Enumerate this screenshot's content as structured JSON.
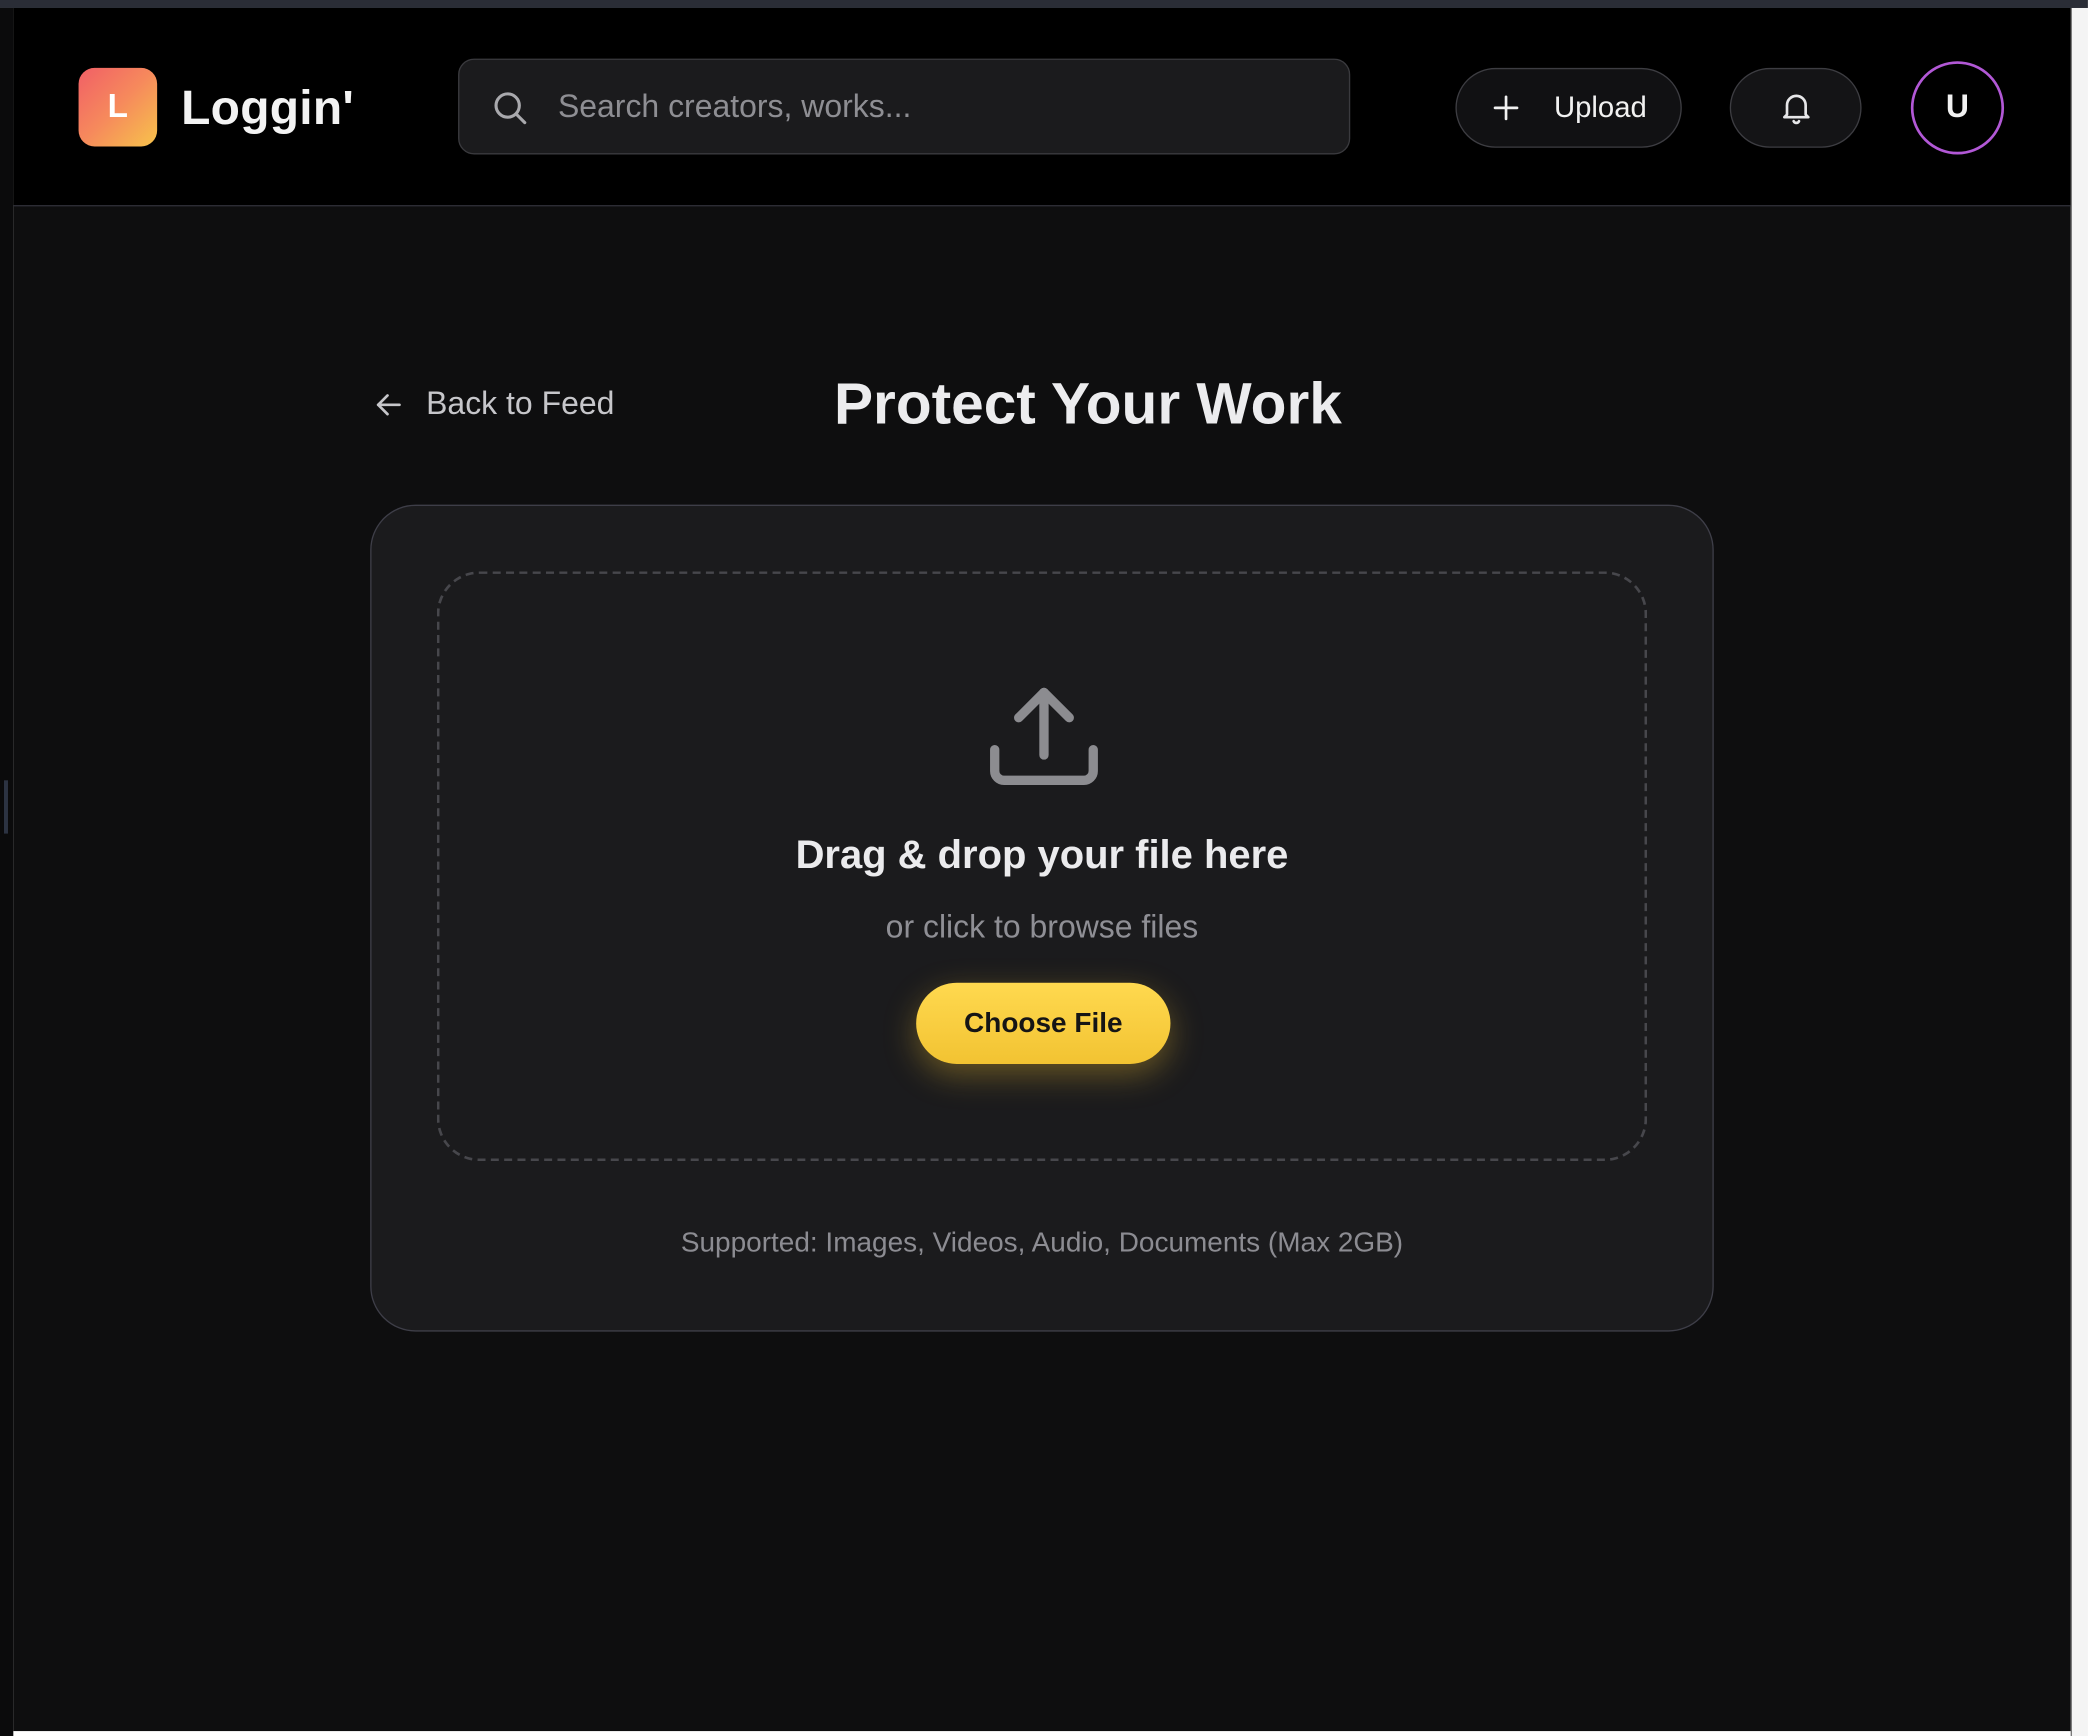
{
  "brand": {
    "logo_letter": "L",
    "name": "Loggin'"
  },
  "search": {
    "placeholder": "Search creators, works..."
  },
  "header": {
    "upload_label": "Upload",
    "avatar_initial": "U"
  },
  "nav": {
    "back_label": "Back to Feed"
  },
  "page": {
    "title": "Protect Your Work"
  },
  "dropzone": {
    "title": "Drag & drop your file here",
    "subtitle": "or click to browse files",
    "button_label": "Choose File"
  },
  "footer_note": "Supported: Images, Videos, Audio, Documents (Max 2GB)",
  "icons": {
    "search": "search-icon",
    "upload_plus": "plus-icon",
    "notifications": "bell-icon",
    "back": "arrow-left-icon",
    "dropzone": "upload-icon"
  },
  "colors": {
    "background": "#0e0e0f",
    "header": "#000000",
    "card": "#1b1b1d",
    "accent_yellow": "#f5c83d",
    "avatar_ring": "#b258d6",
    "logo_gradient_start": "#f15f66",
    "logo_gradient_end": "#f7c34b"
  }
}
